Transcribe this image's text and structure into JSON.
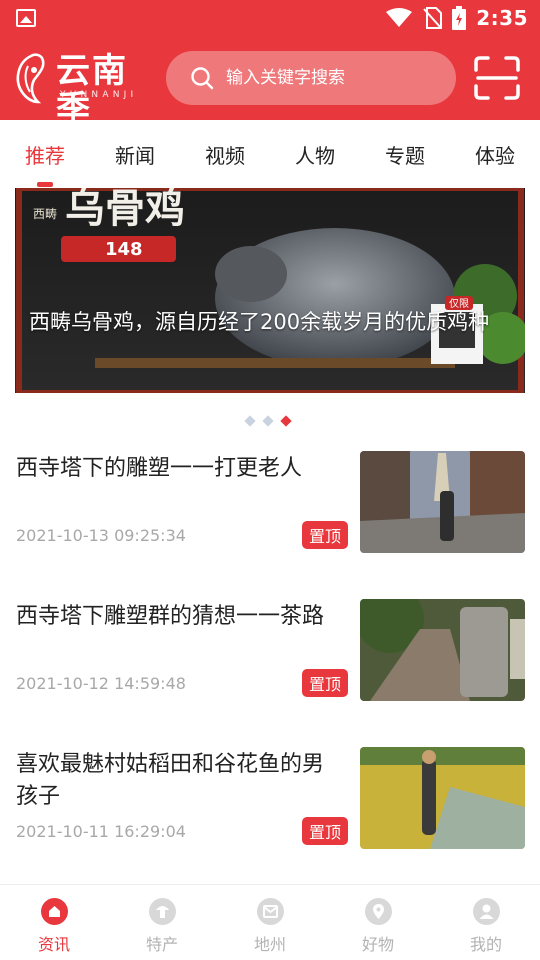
{
  "status_bar": {
    "time": "2:35"
  },
  "header": {
    "logo_text": "云南季",
    "logo_sub": "YUNNANJI",
    "search_placeholder": "输入关键字搜索"
  },
  "tabs": [
    {
      "label": "推荐",
      "active": true
    },
    {
      "label": "新闻",
      "active": false
    },
    {
      "label": "视频",
      "active": false
    },
    {
      "label": "人物",
      "active": false
    },
    {
      "label": "专题",
      "active": false
    },
    {
      "label": "体验",
      "active": false
    }
  ],
  "banner": {
    "caption": "西畴乌骨鸡，源自历经了200余载岁月的优质鸡种",
    "poster_brand": "西畴",
    "poster_title": "乌骨鸡",
    "poster_price": "148",
    "poster_limited": "仅限",
    "slide_count": 3,
    "active_slide": 3
  },
  "articles": [
    {
      "title": "西寺塔下的雕塑一一打更老人",
      "date": "2021-10-13 09:25:34",
      "badge": "置顶"
    },
    {
      "title": "西寺塔下雕塑群的猜想一一茶路",
      "date": "2021-10-12 14:59:48",
      "badge": "置顶"
    },
    {
      "title": "喜欢最魅村姑稻田和谷花鱼的男孩子",
      "date": "2021-10-11 16:29:04",
      "badge": "置顶"
    }
  ],
  "bottom_nav": [
    {
      "label": "资讯",
      "icon": "home-icon",
      "active": true
    },
    {
      "label": "特产",
      "icon": "product-icon",
      "active": false
    },
    {
      "label": "地州",
      "icon": "region-icon",
      "active": false
    },
    {
      "label": "好物",
      "icon": "location-pin-icon",
      "active": false
    },
    {
      "label": "我的",
      "icon": "user-icon",
      "active": false
    }
  ],
  "colors": {
    "brand_red": "#e8383d",
    "muted_gray": "#a8a8a8"
  }
}
